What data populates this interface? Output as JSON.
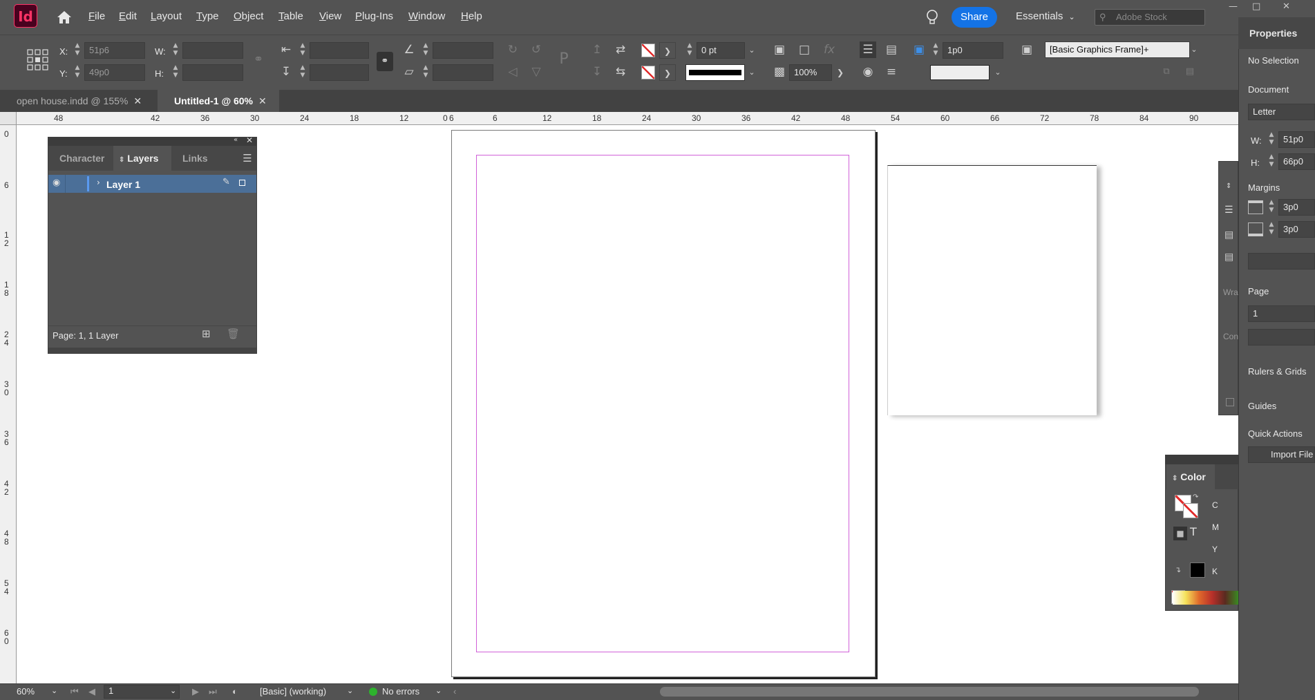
{
  "app": {
    "logo": "Id"
  },
  "menu": [
    "File",
    "Edit",
    "Layout",
    "Type",
    "Object",
    "Table",
    "View",
    "Plug-Ins",
    "Window",
    "Help"
  ],
  "header": {
    "share_label": "Share",
    "workspace": "Essentials",
    "stock_placeholder": "Adobe Stock"
  },
  "control": {
    "x_label": "X:",
    "x_value": "51p6",
    "y_label": "Y:",
    "y_value": "49p0",
    "w_label": "W:",
    "h_label": "H:",
    "stroke_weight": "0 pt",
    "opacity": "100%",
    "frame_offset": "1p0",
    "object_style": "[Basic Graphics Frame]+"
  },
  "tabs": [
    {
      "label": "open house.indd @ 155%"
    },
    {
      "label": "Untitled-1 @ 60%"
    }
  ],
  "ruler": {
    "h_ticks": [
      "48",
      "42",
      "36",
      "30",
      "24",
      "18",
      "12",
      "6",
      "0",
      "6",
      "12",
      "18",
      "24",
      "30",
      "36",
      "42",
      "48",
      "54",
      "60",
      "66",
      "72",
      "78",
      "84",
      "90"
    ],
    "v_ticks": [
      "0",
      "6",
      "12",
      "18",
      "24",
      "30",
      "36",
      "42",
      "48",
      "54",
      "60"
    ]
  },
  "layers_panel": {
    "tabs": [
      "Character",
      "Layers",
      "Links"
    ],
    "layer_name": "Layer 1",
    "status": "Page: 1, 1 Layer"
  },
  "properties": {
    "title": "Properties",
    "selection": "No Selection",
    "document_label": "Document",
    "preset": "Letter",
    "w_label": "W:",
    "w_value": "51p0",
    "h_label": "H:",
    "h_value": "66p0",
    "margins_label": "Margins",
    "margin_top": "3p0",
    "margin_bottom": "3p0",
    "page_label": "Page",
    "page_value": "1",
    "rulers_label": "Rulers & Grids",
    "guides_label": "Guides",
    "quick_actions_label": "Quick Actions",
    "import_file_label": "Import File"
  },
  "side_strip": {
    "wrap_label": "Wra",
    "con_label": "Con"
  },
  "color_panel": {
    "title": "Color",
    "channels": [
      "C",
      "M",
      "Y",
      "K"
    ]
  },
  "status": {
    "zoom": "60%",
    "page": "1",
    "preflight_profile": "[Basic] (working)",
    "errors": "No errors"
  },
  "colors": {
    "ui_dark": "#535353",
    "accent_blue": "#1473e6",
    "margin_guide": "#d060d8",
    "indesign_magenta": "#ff3366",
    "no_errors_green": "#2db32d"
  }
}
